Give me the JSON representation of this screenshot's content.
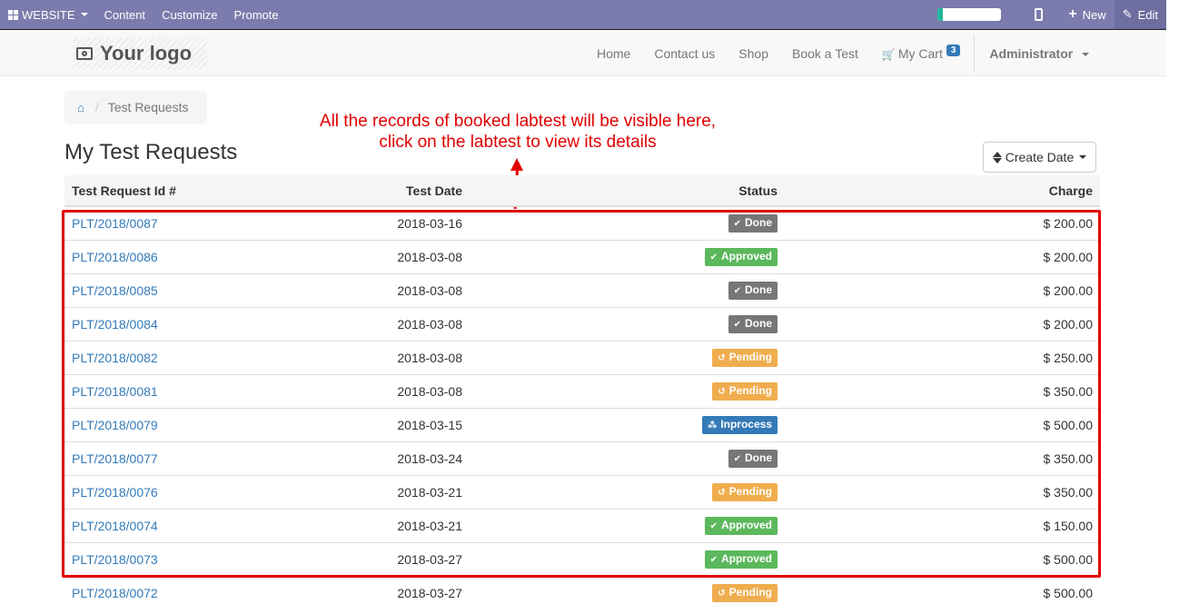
{
  "adminbar": {
    "website_label": "WEBSITE",
    "content_label": "Content",
    "customize_label": "Customize",
    "promote_label": "Promote",
    "progress_fraction": 0.08,
    "new_label": "New",
    "edit_label": "Edit",
    "color": "#7c7bad"
  },
  "header": {
    "logo_text": "Your logo",
    "menu": {
      "home": "Home",
      "contact": "Contact us",
      "shop": "Shop",
      "book": "Book a Test",
      "cart": "My Cart",
      "cart_count": "3",
      "user": "Administrator"
    }
  },
  "breadcrumb": {
    "current": "Test Requests"
  },
  "page": {
    "title": "My Test Requests",
    "sort_label": "Create Date"
  },
  "annotation": {
    "line1": "All the records of booked labtest will be visible here,",
    "line2": "click on the labtest to view its details",
    "color": "#e00000"
  },
  "table": {
    "headers": [
      "Test Request Id #",
      "Test Date",
      "Status",
      "Charge"
    ],
    "rows": [
      {
        "id": "PLT/2018/0087",
        "date": "2018-03-16",
        "status": "Done",
        "charge": "$ 200.00"
      },
      {
        "id": "PLT/2018/0086",
        "date": "2018-03-08",
        "status": "Approved",
        "charge": "$ 200.00"
      },
      {
        "id": "PLT/2018/0085",
        "date": "2018-03-08",
        "status": "Done",
        "charge": "$ 200.00"
      },
      {
        "id": "PLT/2018/0084",
        "date": "2018-03-08",
        "status": "Done",
        "charge": "$ 200.00"
      },
      {
        "id": "PLT/2018/0082",
        "date": "2018-03-08",
        "status": "Pending",
        "charge": "$ 250.00"
      },
      {
        "id": "PLT/2018/0081",
        "date": "2018-03-08",
        "status": "Pending",
        "charge": "$ 350.00"
      },
      {
        "id": "PLT/2018/0079",
        "date": "2018-03-15",
        "status": "Inprocess",
        "charge": "$ 500.00"
      },
      {
        "id": "PLT/2018/0077",
        "date": "2018-03-24",
        "status": "Done",
        "charge": "$ 350.00"
      },
      {
        "id": "PLT/2018/0076",
        "date": "2018-03-21",
        "status": "Pending",
        "charge": "$ 350.00"
      },
      {
        "id": "PLT/2018/0074",
        "date": "2018-03-21",
        "status": "Approved",
        "charge": "$ 150.00"
      },
      {
        "id": "PLT/2018/0073",
        "date": "2018-03-27",
        "status": "Approved",
        "charge": "$ 500.00"
      },
      {
        "id": "PLT/2018/0072",
        "date": "2018-03-27",
        "status": "Pending",
        "charge": "$ 500.00"
      }
    ],
    "status_styles": {
      "Done": {
        "color": "#777777",
        "icon": "check-icon"
      },
      "Approved": {
        "color": "#5cb85c",
        "icon": "check-icon"
      },
      "Pending": {
        "color": "#f0ad4e",
        "icon": "history-icon"
      },
      "Inprocess": {
        "color": "#337ab7",
        "icon": "spinner-icon"
      }
    }
  }
}
